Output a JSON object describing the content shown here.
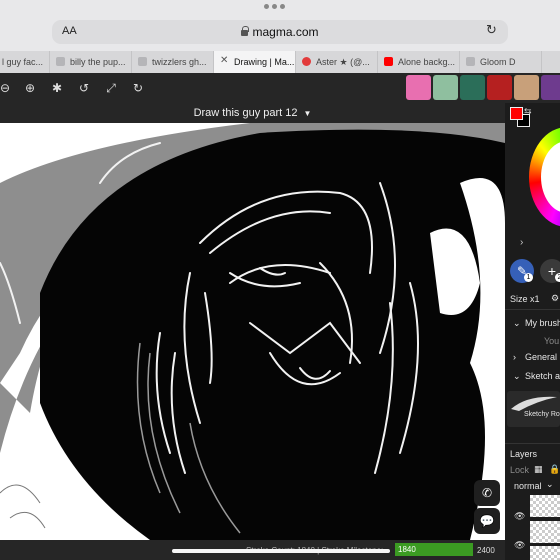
{
  "browser": {
    "text_size_label": "AA",
    "url": "magma.com",
    "tabs": [
      {
        "label": "l guy fac..."
      },
      {
        "label": "billy the pup..."
      },
      {
        "label": "twizzlers gh..."
      },
      {
        "label": "Drawing | Ma...",
        "active": true
      },
      {
        "label": "Aster ★ (@..."
      },
      {
        "label": "Alone backg..."
      },
      {
        "label": "Gloom D"
      }
    ]
  },
  "toolbar": {
    "tools": [
      "zoom-out-icon",
      "zoom-in-icon",
      "fit-icon",
      "rotate-left-icon",
      "rotate-right-icon",
      "fullscreen-icon",
      "fullscreen-alt-icon"
    ],
    "avatar_colors": [
      "#e86fb0",
      "#8fbf9f",
      "#2b6e59",
      "#b52020",
      "#c8a07a",
      "#6e3b8e"
    ]
  },
  "drawing": {
    "title": "Draw this guy part 12"
  },
  "status": {
    "stroke_text": "Stroke Count: 1840 | Stroke Milestone:",
    "progress_value": "1840",
    "progress_max": "2400",
    "progress_fraction": 0.77
  },
  "panel": {
    "colors": {
      "foreground": "#ff0000",
      "background": "#000000"
    },
    "brush_badge": "1",
    "plus_badge": "2",
    "size_label": "Size x1",
    "my_brushes_label": "My brush",
    "you_label": "You",
    "general_label": "General",
    "sketch_label": "Sketch ar",
    "brush_name": "Sketchy Ro",
    "layers_label": "Layers",
    "lock_label": "Lock",
    "blend_mode": "normal"
  }
}
